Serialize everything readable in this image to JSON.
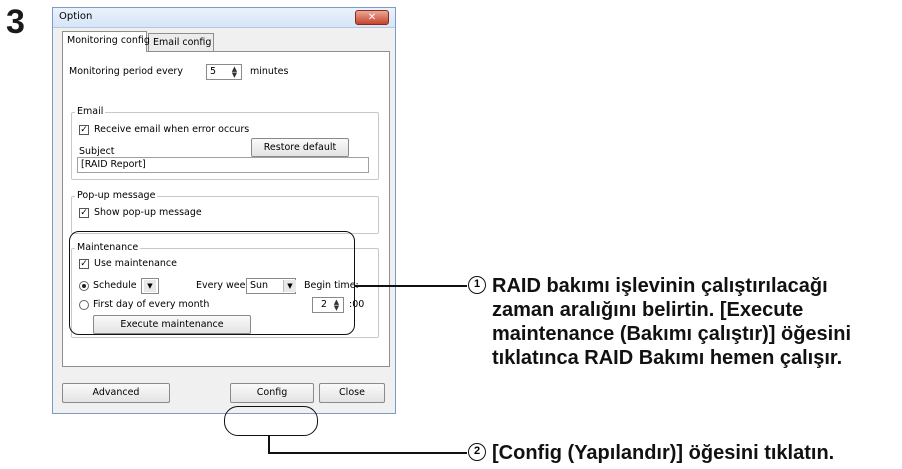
{
  "step_number": "3",
  "dialog": {
    "title": "Option",
    "close_glyph": "✕",
    "tabs": [
      "Monitoring config",
      "Email config"
    ],
    "monitoring": {
      "prefix": "Monitoring period every",
      "value": "5",
      "suffix": "minutes"
    },
    "email": {
      "group_label": "Email",
      "receive_label": "Receive email when error occurs",
      "receive_checked": true,
      "subject_label": "Subject",
      "restore_button": "Restore default",
      "subject_value": "[RAID Report]"
    },
    "popup": {
      "group_label": "Pop-up message",
      "show_label": "Show pop-up message",
      "show_checked": true
    },
    "maintenance": {
      "group_label": "Maintenance",
      "use_label": "Use maintenance",
      "use_checked": true,
      "schedule_label": "Schedule",
      "schedule_selected": true,
      "every_week_label": "Every week",
      "day_value": "Sun",
      "begin_time_label": "Begin time:",
      "first_day_label": "First day of every month",
      "hour_value": "2",
      "minute_suffix": ":00",
      "execute_button": "Execute maintenance"
    },
    "buttons": {
      "advanced": "Advanced",
      "config": "Config",
      "close": "Close"
    }
  },
  "callouts": [
    {
      "number": "1",
      "lines": [
        "RAID bakımı işlevinin çalıştırılacağı",
        "zaman aralığını belirtin. [Execute",
        "maintenance (Bakımı çalıştır)] öğesini",
        "tıklatınca RAID Bakımı hemen çalışır."
      ]
    },
    {
      "number": "2",
      "lines": [
        "[Config (Yapılandır)] öğesini tıklatın."
      ]
    }
  ]
}
